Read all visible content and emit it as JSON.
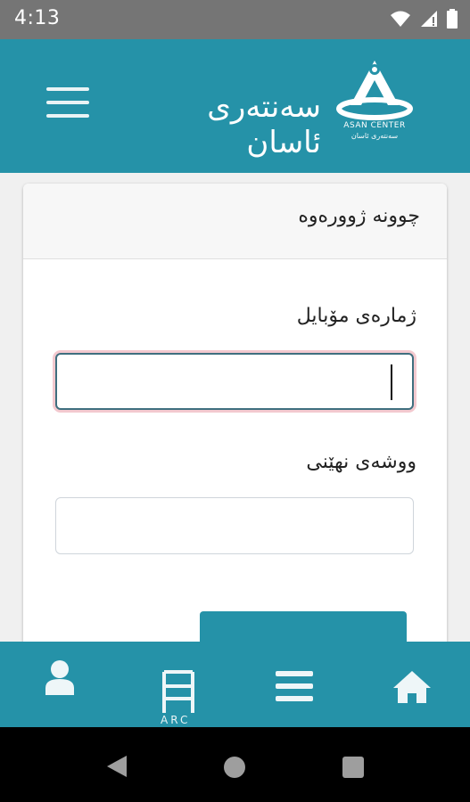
{
  "status_bar": {
    "time": "4:13"
  },
  "app_bar": {
    "title": "سەنتەری ئاسان",
    "logo_text_en": "ASAN CENTER",
    "logo_text_ku": "سەنتەری ئاسان"
  },
  "login_card": {
    "title": "چوونە ژوورەوە",
    "mobile_label": "ژمارەی مۆبایل",
    "mobile_value": "",
    "password_label": "ووشەی نهێنی",
    "password_value": ""
  },
  "bottom_nav": {
    "items": [
      {
        "icon": "user-icon"
      },
      {
        "icon": "arc-logo-icon",
        "text": "ARC"
      },
      {
        "icon": "menu-icon"
      },
      {
        "icon": "home-icon"
      }
    ]
  },
  "colors": {
    "primary": "#2592a8",
    "status_bar": "#757575",
    "focus_ring": "#f3c9cf"
  }
}
